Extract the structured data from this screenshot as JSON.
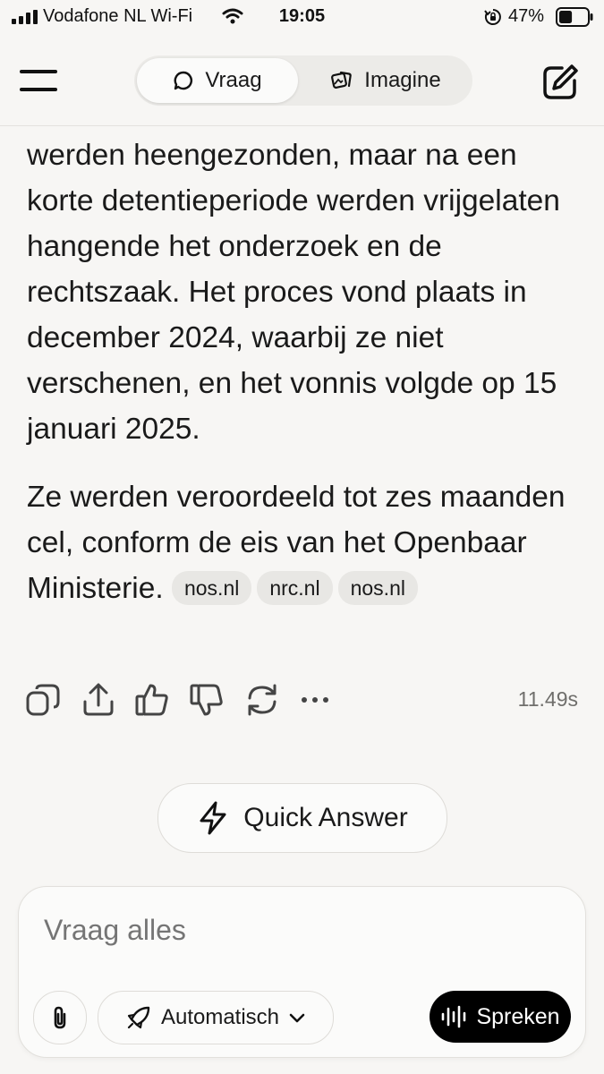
{
  "status_bar": {
    "carrier": "Vodafone NL Wi-Fi",
    "time": "19:05",
    "battery_percent": "47%",
    "battery_level": 0.47
  },
  "header": {
    "tabs": [
      {
        "label": "Vraag",
        "icon": "chat-bubble-icon",
        "selected": true
      },
      {
        "label": "Imagine",
        "icon": "imagine-icon",
        "selected": false
      }
    ],
    "menu_icon": "hamburger-menu-icon",
    "edit_icon": "new-chat-edit-icon"
  },
  "answer": {
    "paragraph1": "werden heengezonden, maar na een korte detentieperiode werden vrijgelaten hangende het onderzoek en de rechtszaak. Het proces vond plaats in december 2024, waarbij ze niet verschenen, en het vonnis volgde op 15 januari 2025.",
    "paragraph2": "Ze werden veroordeeld tot zes maanden cel, conform de eis van het Openbaar Ministerie.",
    "sources": [
      "nos.nl",
      "nrc.nl",
      "nos.nl"
    ]
  },
  "actions": {
    "icons": [
      "copy-icon",
      "share-icon",
      "thumbs-up-icon",
      "thumbs-down-icon",
      "regenerate-icon",
      "more-icon"
    ],
    "duration": "11.49s"
  },
  "quick_answer": {
    "label": "Quick Answer",
    "icon": "lightning-icon"
  },
  "composer": {
    "placeholder": "Vraag alles",
    "mode_label": "Automatisch",
    "speak_label": "Spreken"
  }
}
